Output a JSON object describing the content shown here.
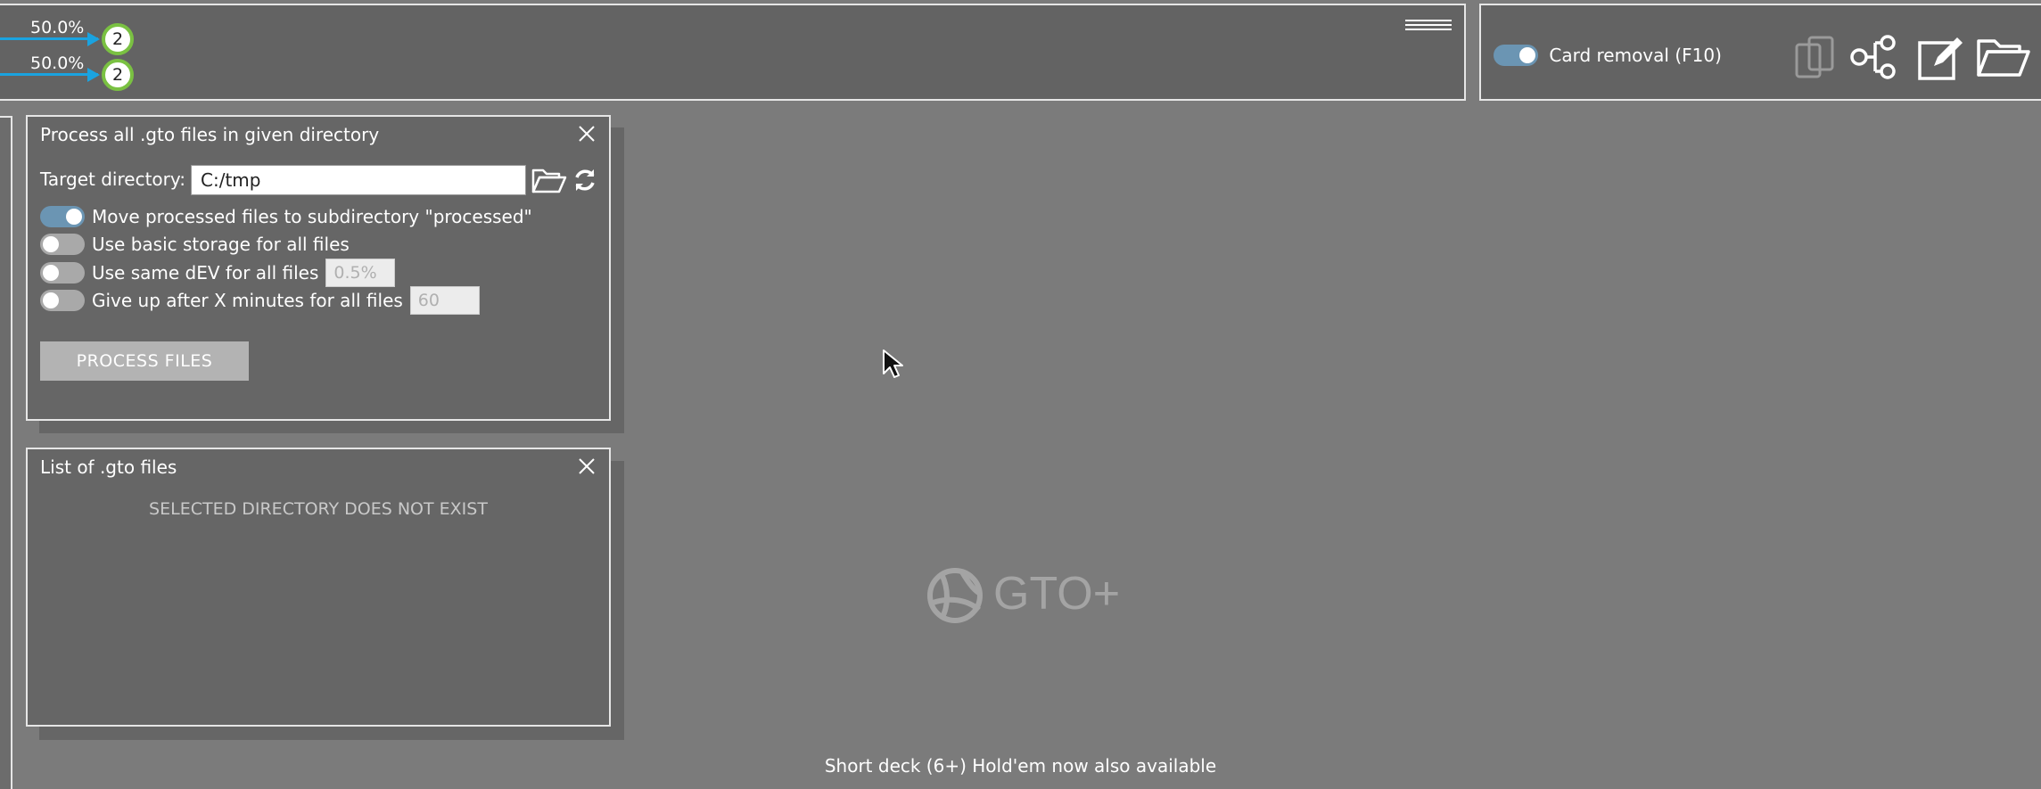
{
  "topbar": {
    "rows": [
      {
        "percent": "50.0%",
        "count": "2"
      },
      {
        "percent": "50.0%",
        "count": "2"
      }
    ]
  },
  "rightbar": {
    "card_removal_label": "Card removal (F10)",
    "card_removal_on": true,
    "icons": [
      "copy-icon",
      "tree-icon",
      "edit-icon",
      "folder-open-icon"
    ]
  },
  "left_sliver": {
    "text": ")"
  },
  "process_panel": {
    "title": "Process all .gto files in given directory",
    "target_label": "Target directory:",
    "target_value": "C:/tmp",
    "options": [
      {
        "label": "Move processed files to subdirectory \"processed\"",
        "on": true
      },
      {
        "label": "Use basic storage for all files",
        "on": false
      },
      {
        "label": "Use same dEV for all files",
        "on": false,
        "input": "0.5%"
      },
      {
        "label": "Give up after X minutes for all files",
        "on": false,
        "input": "60"
      }
    ],
    "button_label": "PROCESS FILES"
  },
  "list_panel": {
    "title": "List of .gto files",
    "empty_message": "SELECTED DIRECTORY DOES NOT EXIST"
  },
  "logo": {
    "text": "GTO+"
  },
  "footer": {
    "text": "Short deck (6+) Hold'em now also available"
  },
  "colors": {
    "accent_blue": "#1aa3e0",
    "badge_green": "#7ac142",
    "toggle_on": "#6b95b3"
  }
}
